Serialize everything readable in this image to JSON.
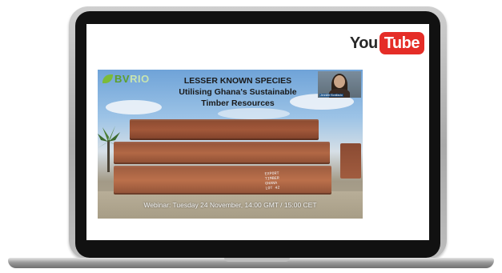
{
  "youtube": {
    "you": "You",
    "tube": "Tube"
  },
  "video": {
    "brand_bv": "BV",
    "brand_rest": "RIO",
    "title_line1": "LESSER KNOWN SPECIES",
    "title_line2": "Utilising Ghana's Sustainable",
    "title_line3": "Timber Resources",
    "caption": "Webinar: Tuesday 24 November,  14:00 GMT / 15:00 CET",
    "webcam_name": "Jennifer Bonifacio",
    "timber_scribble": "EXPORT\nTIMBER\nGHANA\nLOT 42"
  },
  "colors": {
    "youtube_red": "#e52d27",
    "brand_green": "#5d9f2b",
    "laptop_bezel": "#111111"
  }
}
